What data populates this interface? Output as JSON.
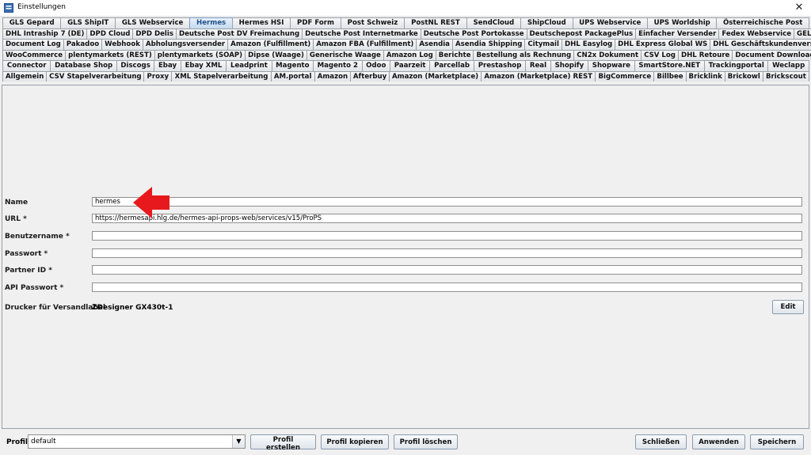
{
  "window": {
    "title": "Einstellungen",
    "close_symbol": "✕"
  },
  "tab_rows": [
    [
      "Allgemein",
      "CSV Stapelverarbeitung",
      "Proxy",
      "XML Stapelverarbeitung",
      "AM.portal",
      "Amazon",
      "Afterbuy",
      "Amazon (Marketplace)",
      "Amazon (Marketplace) REST",
      "BigCommerce",
      "Billbee",
      "Bricklink",
      "Brickowl",
      "Brickscout"
    ],
    [
      "Connector",
      "Database Shop",
      "Discogs",
      "Ebay",
      "Ebay XML",
      "Leadprint",
      "Magento",
      "Magento 2",
      "Odoo",
      "Paarzeit",
      "Parcellab",
      "Prestashop",
      "Real",
      "Shopify",
      "Shopware",
      "SmartStore.NET",
      "Trackingportal",
      "Weclapp"
    ],
    [
      "WooCommerce",
      "plentymarkets (REST)",
      "plentymarkets (SOAP)",
      "Dipse (Waage)",
      "Generische Waage",
      "Amazon Log",
      "Berichte",
      "Bestellung als Rechnung",
      "CN2x Dokument",
      "CSV Log",
      "DHL Retoure",
      "Document Downloader"
    ],
    [
      "Document Log",
      "Pakadoo",
      "Webhook",
      "Abholungsversender",
      "Amazon (Fulfillment)",
      "Amazon FBA (Fulfillment)",
      "Asendia",
      "Asendia Shipping",
      "Citymail",
      "DHL Easylog",
      "DHL Express Global WS",
      "DHL Geschäftskundenversand"
    ],
    [
      "DHL Intraship 7 (DE)",
      "DPD Cloud",
      "DPD Delis",
      "Deutsche Post DV Freimachung",
      "Deutsche Post Internetmarke",
      "Deutsche Post Portokasse",
      "Deutschepost PackagePlus",
      "Einfacher Versender",
      "Fedex Webservice",
      "GEL Express"
    ],
    [
      "GLS Gepard",
      "GLS ShipIT",
      "GLS Webservice",
      "Hermes",
      "Hermes HSI",
      "PDF Form",
      "Post Schweiz",
      "PostNL REST",
      "SendCloud",
      "ShipCloud",
      "UPS Webservice",
      "UPS Worldship",
      "Österreichische Post"
    ]
  ],
  "selected_tab": "Hermes",
  "form": {
    "name_label": "Name",
    "name_value": "hermes",
    "url_label": "URL *",
    "url_value": "https://hermesapi.hlg.de/hermes-api-props-web/services/v15/ProPS",
    "username_label": "Benutzername *",
    "username_value": "",
    "password_label": "Passwort *",
    "password_value": "",
    "partner_label": "Partner ID *",
    "partner_value": "",
    "api_password_label": "API Passwort *",
    "api_password_value": "",
    "printer_label": "Drucker für Versandlabel",
    "printer_value": "ZDesigner GX430t-1",
    "edit_label": "Edit"
  },
  "bottom": {
    "profile_label": "Profil",
    "profile_value": "default",
    "create_label": "Profil erstellen",
    "copy_label": "Profil kopieren",
    "delete_label": "Profil löschen",
    "close_label": "Schließen",
    "apply_label": "Anwenden",
    "save_label": "Speichern"
  },
  "colors": {
    "arrow": "#e8191c",
    "selected_tab_text": "#1f4f8b"
  }
}
